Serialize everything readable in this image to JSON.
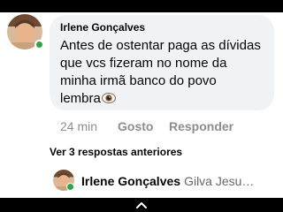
{
  "comment": {
    "author": "Irlene Gonçalves",
    "lines": [
      "Antes de ostentar paga as dívidas",
      "que vcs fizeram no nome da",
      "minha irmã banco do povo",
      "lembra"
    ],
    "emoji": "eye-icon",
    "time": "24 min",
    "like_label": "Gosto",
    "reply_label": "Responder"
  },
  "previous_replies_label": "Ver 3 respostas anteriores",
  "latest_reply": {
    "author": "Irlene Gonçalves",
    "preview": "Gilva Jesu…"
  },
  "colors": {
    "bubble": "#f0f2f5",
    "meta": "#8a8d91",
    "online": "#31a24c"
  }
}
